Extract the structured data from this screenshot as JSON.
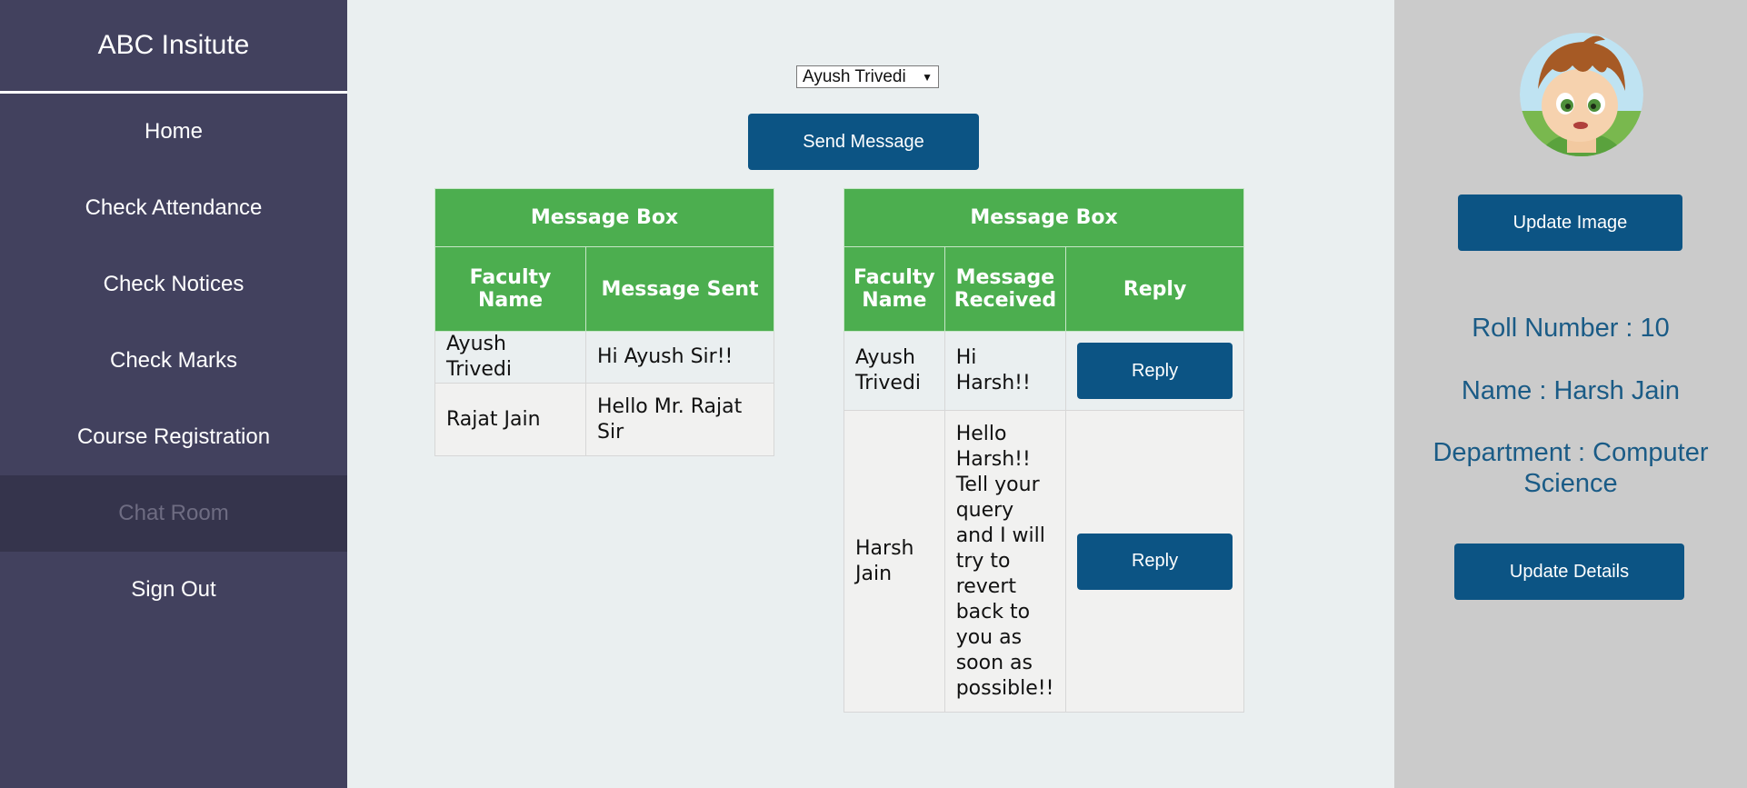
{
  "sidebar": {
    "brand": "ABC Insitute",
    "items": [
      {
        "label": "Home"
      },
      {
        "label": "Check Attendance"
      },
      {
        "label": "Check Notices"
      },
      {
        "label": "Check Marks"
      },
      {
        "label": "Course Registration"
      },
      {
        "label": "Chat Room"
      },
      {
        "label": "Sign Out"
      }
    ],
    "active_item": "Chat Room"
  },
  "main": {
    "faculty_select": {
      "selected": "Ayush Trivedi"
    },
    "send_button": "Send Message",
    "sent_box": {
      "title": "Message Box",
      "headers": [
        "Faculty Name",
        "Message Sent"
      ],
      "rows": [
        {
          "faculty": "Ayush Trivedi",
          "message": "Hi Ayush Sir!!"
        },
        {
          "faculty": "Rajat Jain",
          "message": "Hello Mr. Rajat Sir"
        }
      ]
    },
    "received_box": {
      "title": "Message Box",
      "headers": [
        "Faculty Name",
        "Message Received",
        "Reply"
      ],
      "rows": [
        {
          "faculty": "Ayush Trivedi",
          "message": "Hi Harsh!!",
          "reply_label": "Reply"
        },
        {
          "faculty": "Harsh Jain",
          "message": "Hello Harsh!! Tell your query and I will try to revert back to you as soon as possible!!",
          "reply_label": "Reply"
        }
      ]
    }
  },
  "profile": {
    "update_image_button": "Update Image",
    "roll": "Roll Number : 10",
    "name": "Name : Harsh Jain",
    "department": "Department : Computer Science",
    "update_details_button": "Update Details"
  },
  "colors": {
    "sidebar_bg": "#42415e",
    "header_green": "#4cae4f",
    "button_blue": "#0c5484",
    "profile_text": "#1a5b86"
  }
}
